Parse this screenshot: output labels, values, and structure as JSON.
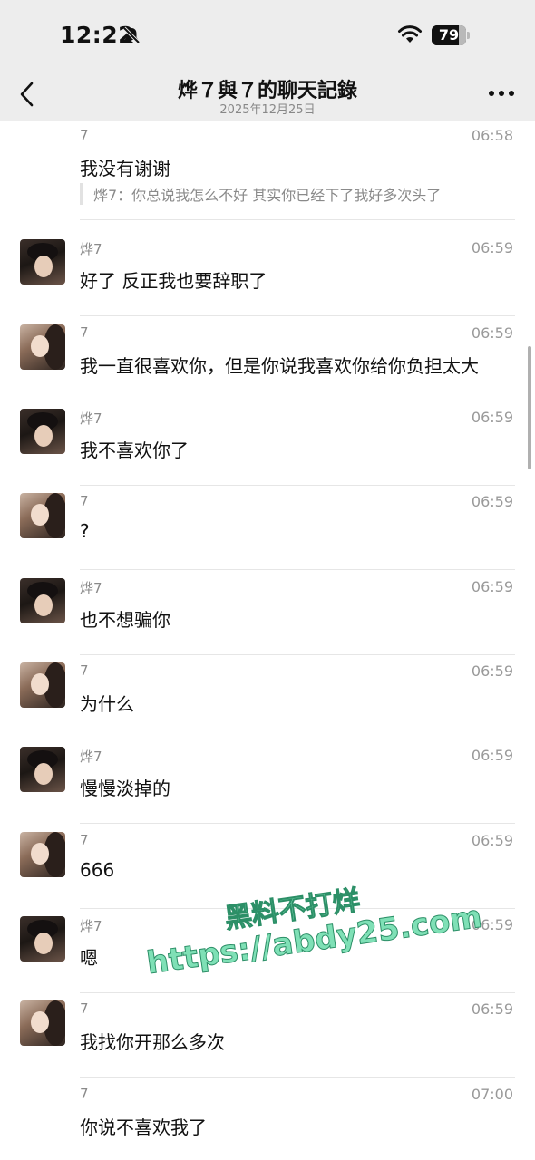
{
  "status_bar": {
    "time": "12:22",
    "battery": "79",
    "battery_level": 0.79
  },
  "nav": {
    "title": "烨７與７的聊天記錄",
    "subtitle": "2025年12月25日"
  },
  "messages": [
    {
      "sender": "7",
      "time": "06:58",
      "text": "我没有谢谢",
      "quote": "烨7：你总说我怎么不好 其实你已经下了我好多次头了",
      "avatar": "none"
    },
    {
      "sender": "烨7",
      "time": "06:59",
      "text": "好了 反正我也要辞职了",
      "avatar": "boy"
    },
    {
      "sender": "7",
      "time": "06:59",
      "text": "我一直很喜欢你，但是你说我喜欢你给你负担太大",
      "avatar": "girl"
    },
    {
      "sender": "烨7",
      "time": "06:59",
      "text": "我不喜欢你了",
      "avatar": "boy"
    },
    {
      "sender": "7",
      "time": "06:59",
      "text": "?",
      "avatar": "girl"
    },
    {
      "sender": "烨7",
      "time": "06:59",
      "text": "也不想骗你",
      "avatar": "boy"
    },
    {
      "sender": "7",
      "time": "06:59",
      "text": "为什么",
      "avatar": "girl"
    },
    {
      "sender": "烨7",
      "time": "06:59",
      "text": "慢慢淡掉的",
      "avatar": "boy"
    },
    {
      "sender": "7",
      "time": "06:59",
      "text": "666",
      "avatar": "girl"
    },
    {
      "sender": "烨7",
      "time": "06:59",
      "text": "嗯",
      "avatar": "boy"
    },
    {
      "sender": "7",
      "time": "06:59",
      "text": "我找你开那么多次",
      "avatar": "girl"
    },
    {
      "sender": "7",
      "time": "07:00",
      "text": "你说不喜欢我了",
      "avatar": "none"
    }
  ],
  "watermark": {
    "line1": "黑料不打烊",
    "line2": "https://abdy25.com"
  }
}
